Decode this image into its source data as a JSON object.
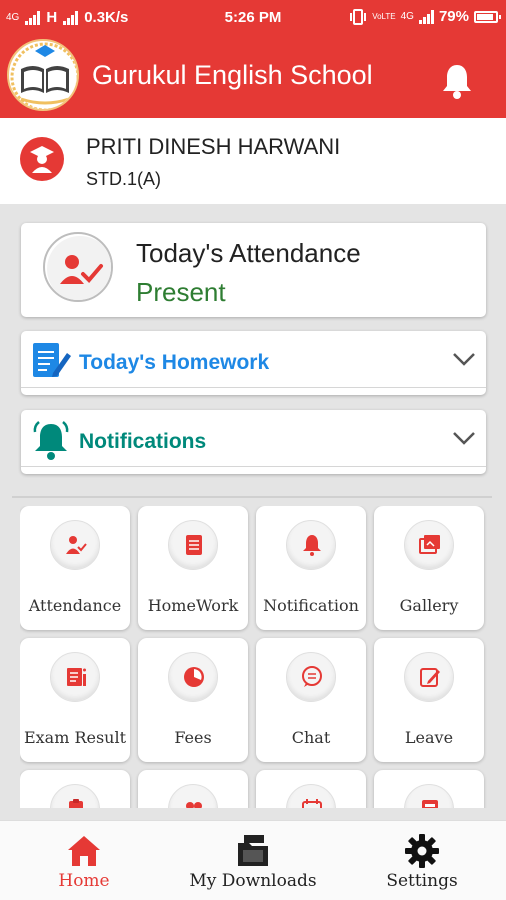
{
  "status_bar": {
    "network1": "4G",
    "network2": "H",
    "speed": "0.3K/s",
    "time": "5:26 PM",
    "volte": "VoLTE",
    "network3": "4G",
    "battery": "79%"
  },
  "app_bar": {
    "title": "Gurukul English School",
    "notification_icon": "bell-icon"
  },
  "student": {
    "name": "PRITI DINESH HARWANI",
    "class": "STD.1(A)"
  },
  "attendance_card": {
    "title": "Today's Attendance",
    "status": "Present",
    "status_color": "#2e7d32"
  },
  "homework_section": {
    "title": "Today's Homework",
    "color": "#1e88e5",
    "icon": "homework-icon"
  },
  "notifications_section": {
    "title": "Notifications",
    "color": "#00897b",
    "icon": "bell-icon"
  },
  "menu_tiles": [
    {
      "label": "Attendance",
      "icon": "attendance-icon"
    },
    {
      "label": "HomeWork",
      "icon": "homework-icon"
    },
    {
      "label": "Notification",
      "icon": "notification-icon"
    },
    {
      "label": "Gallery",
      "icon": "gallery-icon"
    },
    {
      "label": "Exam Result",
      "icon": "exam-result-icon"
    },
    {
      "label": "Fees",
      "icon": "fees-icon"
    },
    {
      "label": "Chat",
      "icon": "chat-icon"
    },
    {
      "label": "Leave",
      "icon": "leave-icon"
    }
  ],
  "bottom_nav": {
    "items": [
      {
        "label": "Home",
        "icon": "home-icon",
        "active": true
      },
      {
        "label": "My Downloads",
        "icon": "downloads-icon",
        "active": false
      },
      {
        "label": "Settings",
        "icon": "gear-icon",
        "active": false
      }
    ]
  },
  "colors": {
    "primary": "#e53935",
    "present": "#2e7d32",
    "homework": "#1e88e5",
    "notifications": "#00897b"
  }
}
